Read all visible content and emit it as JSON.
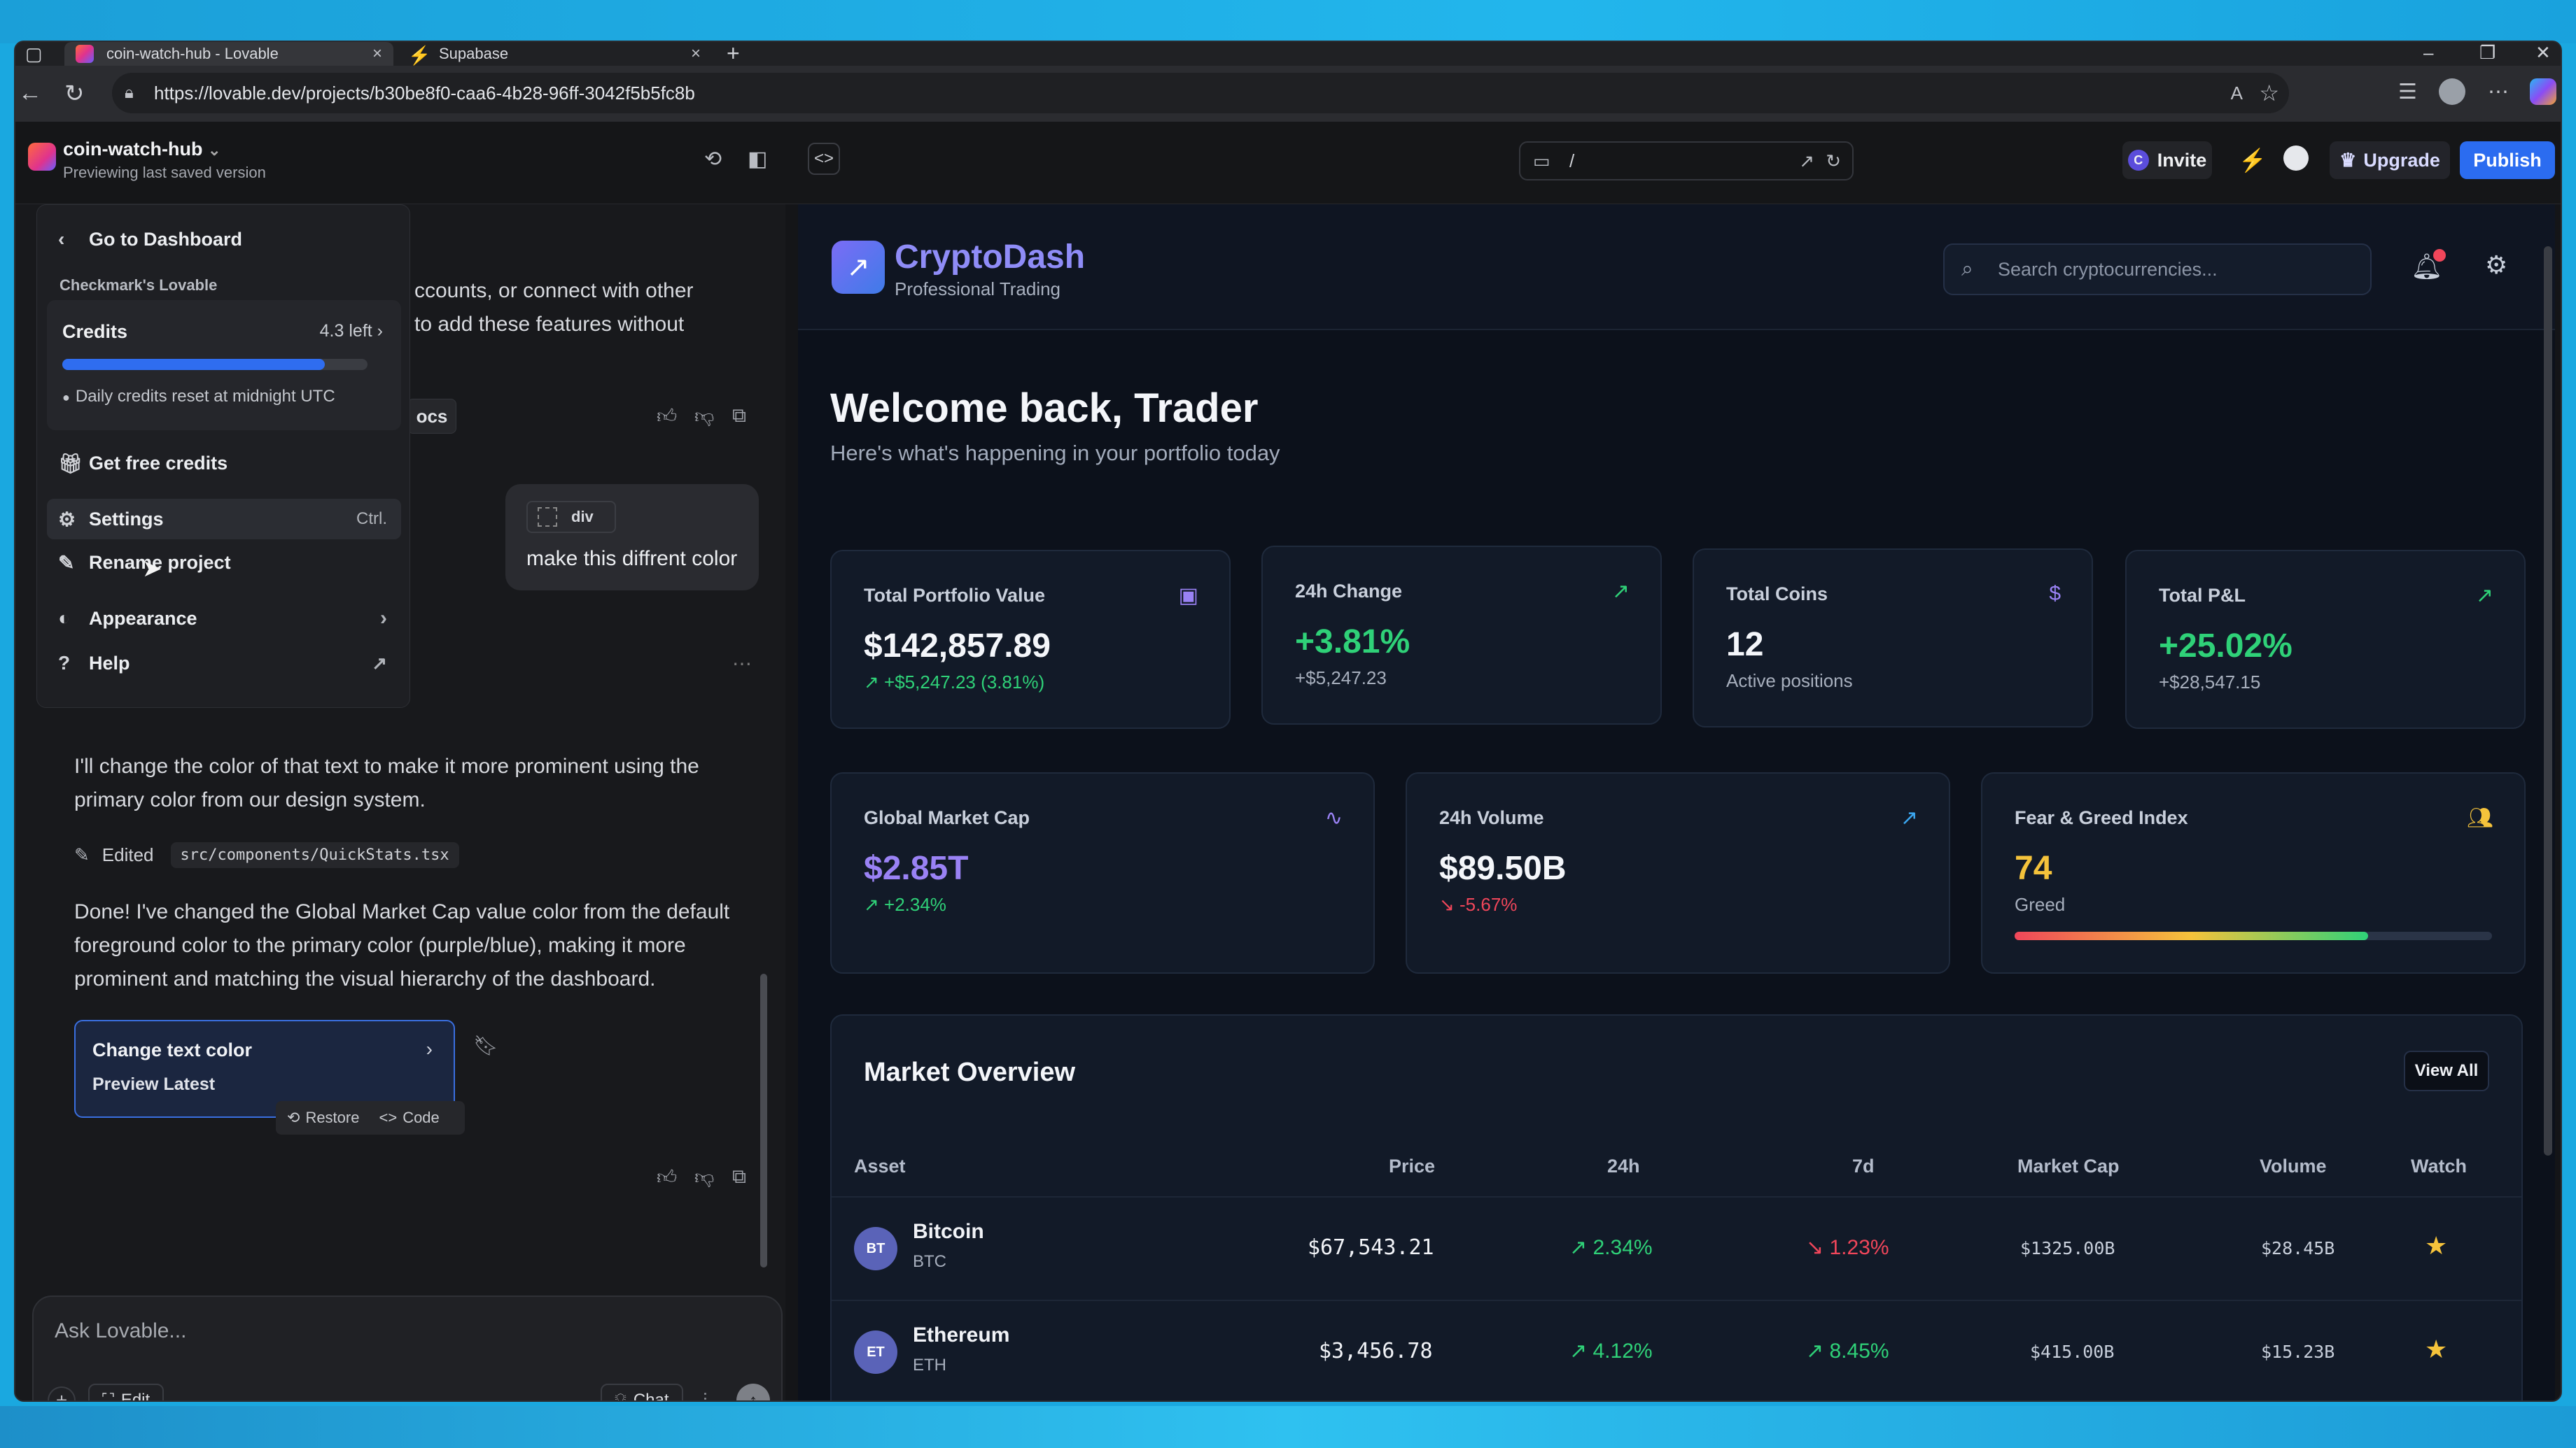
{
  "browser": {
    "tabs": [
      {
        "label": "coin-watch-hub - Lovable",
        "active": true
      },
      {
        "label": "Supabase",
        "active": false
      }
    ],
    "url": "https://lovable.dev/projects/b30be8f0-caa6-4b28-96ff-3042f5b5fc8b"
  },
  "app_header": {
    "project_name": "coin-watch-hub",
    "project_sub": "Previewing last saved version",
    "path": "/",
    "invite": "Invite",
    "invite_initial": "C",
    "upgrade": "Upgrade",
    "publish": "Publish"
  },
  "chat": {
    "partial_text_1": "ccounts, or connect with other",
    "partial_text_2": "to add these features without",
    "partial_chip": "ocs",
    "bubble_tag": "div",
    "bubble_text": "make this diffrent color",
    "reply_1": "I'll change the color of that text to make it more prominent using the primary color from our design system.",
    "edited_label": "Edited",
    "edited_file": "src/components/QuickStats.tsx",
    "reply_2": "Done! I've changed the Global Market Cap value color from the default foreground color to the primary color (purple/blue), making it more prominent and matching the visual hierarchy of the dashboard.",
    "version_title": "Change text color",
    "version_sub": "Preview Latest",
    "restore": "Restore",
    "code": "Code",
    "ask_placeholder": "Ask Lovable...",
    "edit_btn": "Edit",
    "chat_btn": "Chat"
  },
  "menu": {
    "go_dashboard": "Go to Dashboard",
    "workspace": "Checkmark's Lovable",
    "credits_label": "Credits",
    "credits_left": "4.3 left",
    "credits_progress": 0.86,
    "credits_note": "Daily credits reset at midnight UTC",
    "free_credits": "Get free credits",
    "settings": "Settings",
    "settings_shortcut": "Ctrl.",
    "rename": "Rename project",
    "appearance": "Appearance",
    "help": "Help"
  },
  "dashboard": {
    "brand": "CryptoDash",
    "brand_sub": "Professional Trading",
    "search_placeholder": "Search cryptocurrencies...",
    "welcome": "Welcome back, Trader",
    "welcome_sub": "Here's what's happening in your portfolio today",
    "cards": [
      {
        "label": "Total Portfolio Value",
        "value": "$142,857.89",
        "sub": "+$5,247.23 (3.81%)"
      },
      {
        "label": "24h Change",
        "value": "+3.81%",
        "sub": "+$5,247.23"
      },
      {
        "label": "Total Coins",
        "value": "12",
        "sub": "Active positions"
      },
      {
        "label": "Total P&L",
        "value": "+25.02%",
        "sub": "+$28,547.15"
      }
    ],
    "cards2": [
      {
        "label": "Global Market Cap",
        "value": "$2.85T",
        "sub": "+2.34%"
      },
      {
        "label": "24h Volume",
        "value": "$89.50B",
        "sub": "-5.67%"
      },
      {
        "label": "Fear & Greed Index",
        "value": "74",
        "sub": "Greed",
        "gauge": 0.74
      }
    ],
    "market": {
      "title": "Market Overview",
      "view_all": "View All",
      "headers": [
        "Asset",
        "Price",
        "24h",
        "7d",
        "Market Cap",
        "Volume",
        "Watch"
      ],
      "rows": [
        {
          "badge": "BT",
          "name": "Bitcoin",
          "symbol": "BTC",
          "price": "$67,543.21",
          "d24": "2.34%",
          "d7": "1.23%",
          "mcap": "$1325.00B",
          "volume": "$28.45B"
        },
        {
          "badge": "ET",
          "name": "Ethereum",
          "symbol": "ETH",
          "price": "$3,456.78",
          "d24": "4.12%",
          "d7": "8.45%",
          "mcap": "$415.00B",
          "volume": "$15.23B"
        }
      ]
    }
  }
}
